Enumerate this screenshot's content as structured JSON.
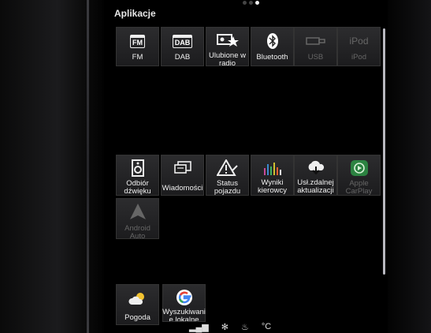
{
  "section_title": "Aplikacje",
  "tiles_row1": [
    {
      "label": "FM",
      "badge": "FM"
    },
    {
      "label": "DAB",
      "badge": "DAB"
    },
    {
      "label": "Ulubione w radio"
    },
    {
      "label": "Bluetooth"
    },
    {
      "label": "USB"
    },
    {
      "label": "iPod",
      "badge": "iPod"
    }
  ],
  "tiles_row2": [
    {
      "label": "Odbiór dźwięku"
    },
    {
      "label": "Wiadomości"
    },
    {
      "label": "Status pojazdu"
    },
    {
      "label": "Wyniki kierowcy"
    },
    {
      "label": "Usł.zdalnej aktualizacji"
    },
    {
      "label": "Apple CarPlay"
    }
  ],
  "tiles_row3": [
    {
      "label": "Android Auto"
    }
  ],
  "tiles_row4": [
    {
      "label": "Pogoda"
    },
    {
      "label": "Wyszukiwani e lokalne"
    }
  ],
  "status_bar": {
    "temp": "°C"
  },
  "colors": {
    "background": "#000000",
    "tile": "#262628",
    "carplay_green": "#2ea24a",
    "disabled_text": "#666666"
  }
}
